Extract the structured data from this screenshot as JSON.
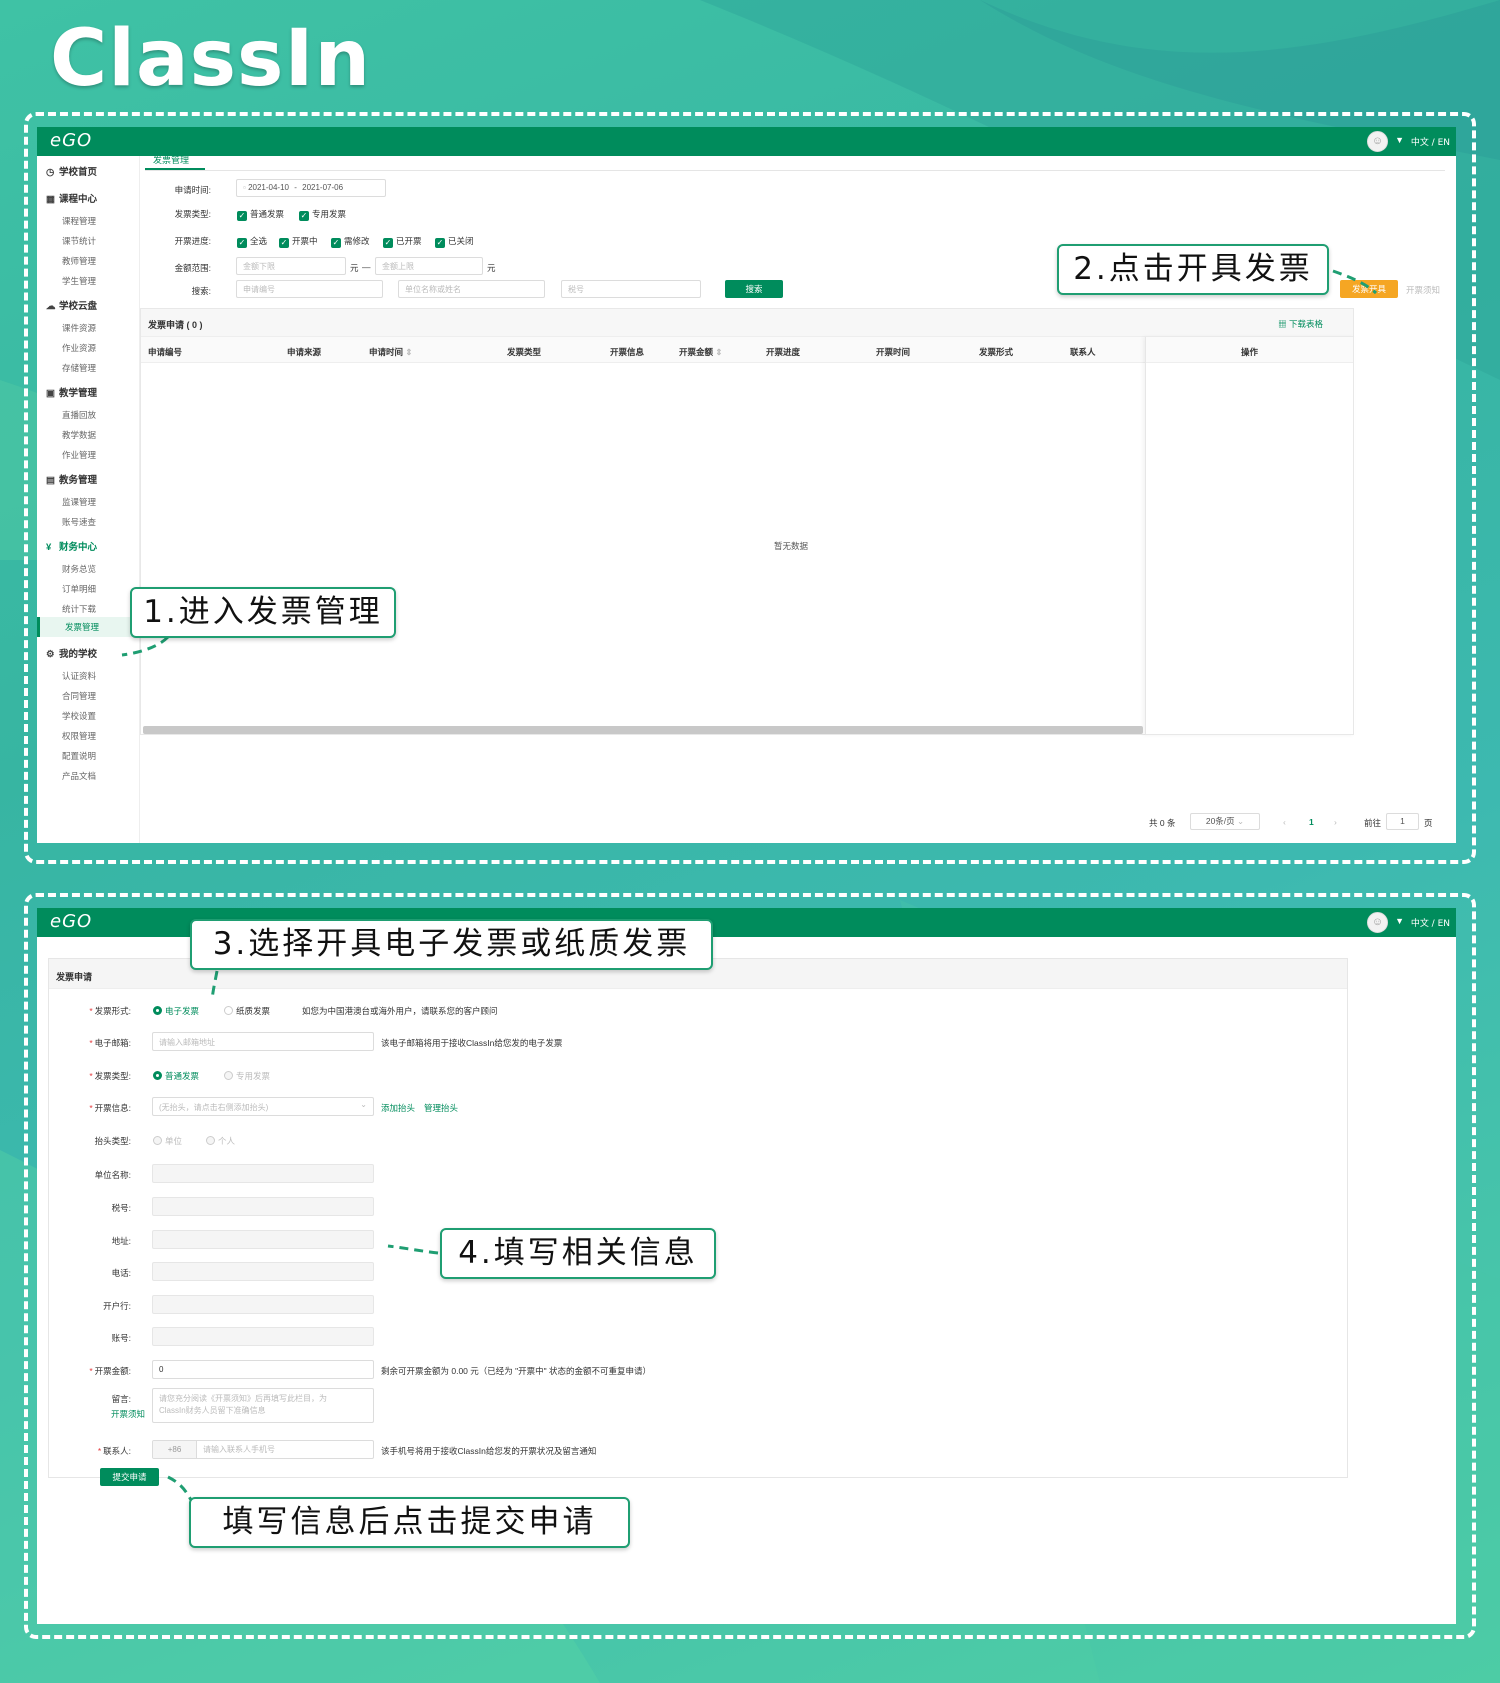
{
  "brand_logo": "ClassIn",
  "colors": {
    "brand_green": "#008c5c",
    "accent_orange": "#f5a623",
    "bg_teal": "#3fc2a5"
  },
  "panel1": {
    "app_logo": "eGO",
    "lang": "中文 / EN",
    "sidebar": {
      "groups": [
        {
          "icon": "clock-icon",
          "label": "学校首页",
          "items": []
        },
        {
          "icon": "calendar-icon",
          "label": "课程中心",
          "items": [
            "课程管理",
            "课节统计",
            "教师管理",
            "学生管理"
          ]
        },
        {
          "icon": "cloud-icon",
          "label": "学校云盘",
          "items": [
            "课件资源",
            "作业资源",
            "存储管理"
          ]
        },
        {
          "icon": "board-icon",
          "label": "教学管理",
          "items": [
            "直播回放",
            "教学数据",
            "作业管理"
          ]
        },
        {
          "icon": "grid-icon",
          "label": "教务管理",
          "items": [
            "监课管理",
            "账号速查"
          ]
        },
        {
          "icon": "yen-icon",
          "label": "财务中心",
          "items": [
            "财务总览",
            "订单明细",
            "统计下载",
            "发票管理"
          ]
        },
        {
          "icon": "gear-icon",
          "label": "我的学校",
          "items": [
            "认证资料",
            "合同管理",
            "学校设置",
            "权限管理",
            "配置说明",
            "产品文档"
          ]
        }
      ],
      "active_group": "财务中心",
      "active_item": "发票管理"
    },
    "tab": "发票管理",
    "filters": {
      "date_label": "申请时间:",
      "date_start": "2021-04-10",
      "date_sep": "-",
      "date_end": "2021-07-06",
      "type_label": "发票类型:",
      "types": [
        "普通发票",
        "专用发票"
      ],
      "progress_label": "开票进度:",
      "progress": [
        "全选",
        "开票中",
        "需修改",
        "已开票",
        "已关闭"
      ],
      "amount_label": "金额范围:",
      "amount_min_placeholder": "金额下限",
      "amount_unit": "元",
      "amount_sep": "—",
      "amount_max_placeholder": "金额上限",
      "search_label": "搜索:",
      "search_placeholders": [
        "申请编号",
        "单位名称或姓名",
        "税号"
      ],
      "search_button": "搜索"
    },
    "issue_button": "发票开具",
    "issue_notice_link": "开票须知",
    "table": {
      "title": "发票申请 ( 0 )",
      "download": "下载表格",
      "columns": [
        "申请编号",
        "申请来源",
        "申请时间",
        "发票类型",
        "开票信息",
        "开票金额",
        "开票进度",
        "开票时间",
        "发票形式",
        "联系人",
        "操作"
      ],
      "empty_text": "暂无数据"
    },
    "pagination": {
      "total": "共 0 条",
      "page_size": "20条/页",
      "current_page": "1",
      "goto_label": "前往",
      "goto_value": "1",
      "page_unit": "页"
    }
  },
  "panel2": {
    "app_logo": "eGO",
    "lang": "中文 / EN",
    "card_title": "发票申请",
    "form": {
      "form_label": "发票形式:",
      "form_options": [
        "电子发票",
        "纸质发票"
      ],
      "form_note": "如您为中国港澳台或海外用户，请联系您的客户顾问",
      "email_label": "电子邮箱:",
      "email_placeholder": "请输入邮箱地址",
      "email_note": "该电子邮箱将用于接收ClassIn给您发的电子发票",
      "type_label": "发票类型:",
      "type_options": [
        "普通发票",
        "专用发票"
      ],
      "info_label": "开票信息:",
      "info_placeholder": "(无抬头，请点击右侧添加抬头)",
      "add_header": "添加抬头",
      "manage_header": "管理抬头",
      "header_type_label": "抬头类型:",
      "header_type_options": [
        "单位",
        "个人"
      ],
      "company_label": "单位名称:",
      "tax_label": "税号:",
      "address_label": "地址:",
      "phone_label": "电话:",
      "bank_label": "开户行:",
      "account_label": "账号:",
      "amount_label": "开票金额:",
      "amount_value": "0",
      "amount_note": "剩余可开票金额为 0.00 元（已经为 \"开票中\" 状态的金额不可重复申请）",
      "message_label": "留言:",
      "message_link": "开票须知",
      "message_placeholder_1": "请您充分阅读《开票须知》后再填写此栏目，为",
      "message_placeholder_2": "ClassIn财务人员留下准确信息",
      "contact_label": "联系人:",
      "contact_code": "+86",
      "contact_placeholder": "请输入联系人手机号",
      "contact_note": "该手机号将用于接收ClassIn给您发的开票状况及留言通知",
      "submit": "提交申请"
    }
  },
  "callouts": {
    "step1": "1.进入发票管理",
    "step2": "2.点击开具发票",
    "step3": "3.选择开具电子发票或纸质发票",
    "step4": "4.填写相关信息",
    "step5": "填写信息后点击提交申请"
  }
}
